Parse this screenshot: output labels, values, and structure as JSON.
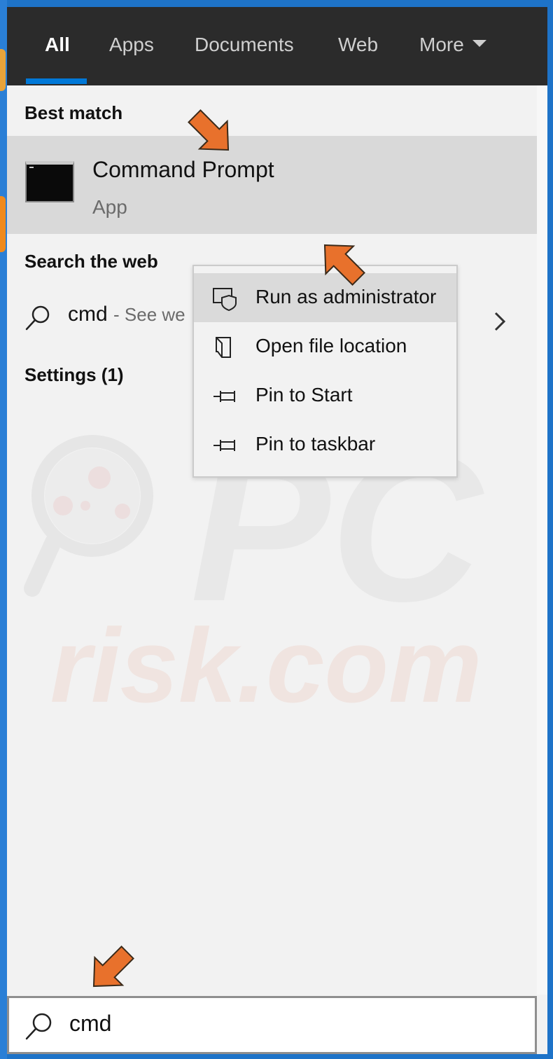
{
  "tabs": [
    {
      "label": "All"
    },
    {
      "label": "Apps"
    },
    {
      "label": "Documents"
    },
    {
      "label": "Web"
    },
    {
      "label": "More"
    }
  ],
  "best_match": {
    "heading": "Best match",
    "title": "Command Prompt",
    "subtitle": "App"
  },
  "search_web": {
    "heading": "Search the web",
    "query": "cmd",
    "suffix": "- See we"
  },
  "settings": {
    "heading": "Settings (1)"
  },
  "context_menu": {
    "items": [
      {
        "label": "Run as administrator",
        "icon": "shield-icon"
      },
      {
        "label": "Open file location",
        "icon": "folder-icon"
      },
      {
        "label": "Pin to Start",
        "icon": "pin-icon"
      },
      {
        "label": "Pin to taskbar",
        "icon": "pin-icon"
      }
    ]
  },
  "search_box": {
    "value": "cmd"
  },
  "watermark": {
    "text_top": "PC",
    "text_bottom": "risk.com"
  },
  "colors": {
    "accent": "#0078d7",
    "annotation_arrow": "#e8712c",
    "topbar": "#2b2b2b",
    "highlight": "#d9d9d9"
  }
}
